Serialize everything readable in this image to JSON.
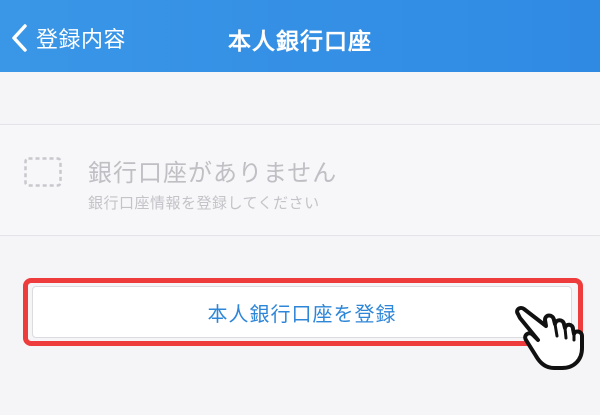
{
  "header": {
    "back_label": "登録内容",
    "title": "本人銀行口座",
    "background_color": "#3a96e6"
  },
  "empty_state": {
    "title": "銀行口座がありません",
    "subtitle": "銀行口座情報を登録してください",
    "icon": "dashed-box-icon"
  },
  "register_button": {
    "label": "本人銀行口座を登録",
    "text_color": "#2d86d8"
  },
  "annotation": {
    "highlight_color": "#ee3b3b",
    "pointer_icon": "pointing-hand-icon"
  }
}
